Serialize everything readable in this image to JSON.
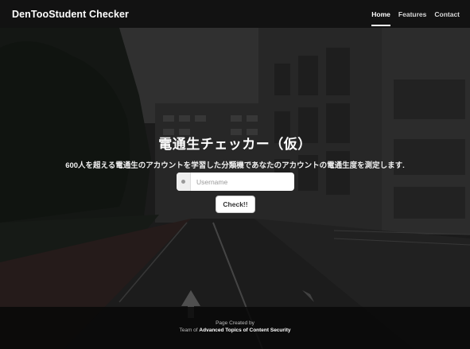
{
  "navbar": {
    "brand": "DenTooStudent Checker",
    "items": [
      {
        "label": "Home",
        "active": true
      },
      {
        "label": "Features",
        "active": false
      },
      {
        "label": "Contact",
        "active": false
      }
    ]
  },
  "hero": {
    "title": "電通生チェッカー（仮）",
    "subtitle": "600人を超える電通生のアカウントを学習した分類機であなたのアカウントの電通生度を測定します."
  },
  "form": {
    "username_placeholder": "Username",
    "username_value": "",
    "check_label": "Check!!"
  },
  "footer": {
    "line1": "Page Created by",
    "line2_prefix": "Team of",
    "line2_team": "Advanced Topics of Content Security"
  },
  "colors": {
    "navbar_bg": "#0f0f0f",
    "text_primary": "#ffffff",
    "button_bg": "#ffffff"
  }
}
